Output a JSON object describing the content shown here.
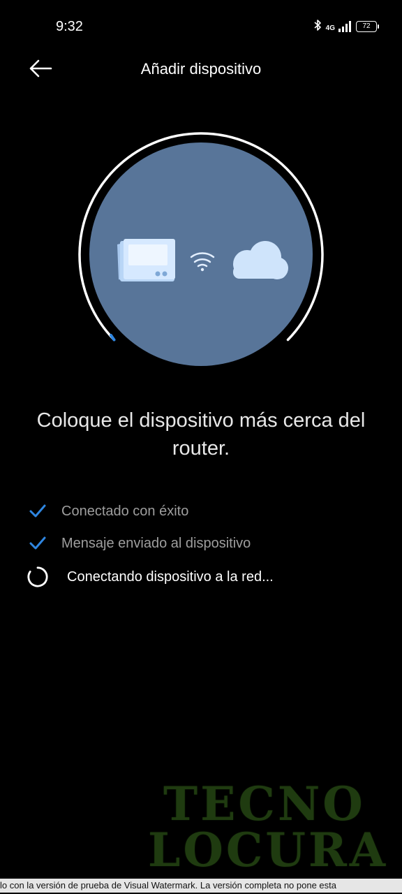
{
  "status_bar": {
    "time": "9:32",
    "network": "4G",
    "battery": "72",
    "icons": [
      "bluetooth-icon",
      "signal-icon",
      "battery-icon"
    ]
  },
  "header": {
    "title": "Añadir dispositivo",
    "back_icon": "arrow-left-icon"
  },
  "illustration": {
    "icons": [
      "device-icon",
      "wifi-icon",
      "cloud-icon"
    ],
    "colors": {
      "circle": "#587599",
      "ring": "#ffffff",
      "progress_accent": "#2f86e0",
      "device_light": "#d6e9ff",
      "cloud": "#cfe4fb"
    }
  },
  "message": "Coloque el dispositivo más cerca del router.",
  "steps": [
    {
      "label": "Conectado con éxito",
      "status": "done",
      "icon": "check-icon"
    },
    {
      "label": "Mensaje enviado al dispositivo",
      "status": "done",
      "icon": "check-icon"
    },
    {
      "label": "Conectando dispositivo a la red...",
      "status": "in-progress",
      "icon": "spinner-icon"
    }
  ],
  "accent_color": "#2f86e0",
  "watermark": {
    "logo_line1": "TECNO",
    "logo_line2": "LOCURA",
    "banner": "lo con la versión de prueba de Visual Watermark. La versión completa no pone esta"
  }
}
